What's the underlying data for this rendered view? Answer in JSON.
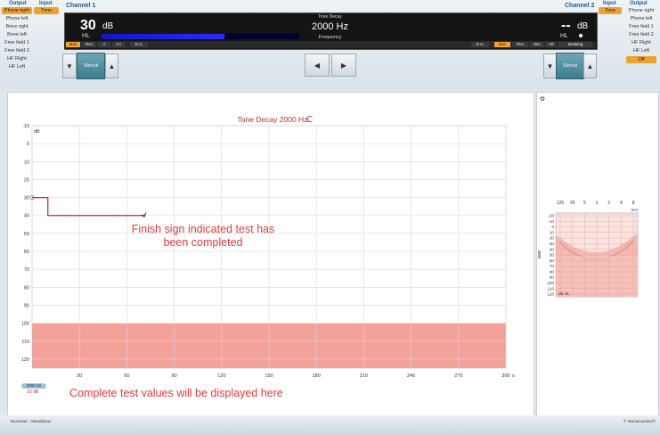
{
  "left_panel": {
    "output_header": "Output",
    "input_header": "Input",
    "outputs": [
      "Phone right",
      "Phone left",
      "Bone right",
      "Bone left",
      "Free field 1",
      "Free field 2",
      "HF Right",
      "HF Left"
    ],
    "input_value": "Tone"
  },
  "right_panel": {
    "input_header": "Input",
    "output_header": "Output",
    "input_value": "Tone",
    "outputs": [
      "Phone right",
      "Phone left",
      "Free field 1",
      "Free field 2",
      "HF Right",
      "HF Left"
    ],
    "off_label": "Off"
  },
  "channel1_label": "Channel 1",
  "channel2_label": "Channel 2",
  "display": {
    "title": "Tone Decay",
    "ch1_level": "30",
    "ch1_unit": "dB",
    "ch1_hl": "HL",
    "frequency": "2000 Hz",
    "frequency_label": "Frequency",
    "ch2_level": "--",
    "ch2_unit": "dB",
    "ch2_hl": "HL",
    "level_bar_fill": 0.62,
    "left_tabs": [
      "Man",
      "Rev",
      "⎍",
      "⎍⎍",
      "E+L"
    ],
    "right_tabs": [
      "E+L",
      "Man",
      "Rev",
      "Sim",
      "Alt",
      "Masking"
    ],
    "left_tab_active": 0,
    "right_tab_active": 1
  },
  "buttons": {
    "stimuli_left": "Stimuli",
    "stimuli_right": "Stimuli"
  },
  "chart_data": {
    "type": "line",
    "title": "Tone Decay 2000 Hz",
    "ylabel": "dB",
    "xlabel": "s",
    "x_ticks": [
      "30",
      "60",
      "90",
      "120",
      "150",
      "180",
      "210",
      "240",
      "270",
      "300"
    ],
    "y_ticks": [
      "-10",
      "0",
      "10",
      "20",
      "30",
      "40",
      "50",
      "60",
      "70",
      "80",
      "90",
      "100",
      "110",
      "120"
    ],
    "xlim": [
      0,
      300
    ],
    "ylim": [
      -10,
      125
    ],
    "shaded_region": [
      100,
      125
    ],
    "grid": true,
    "series": [
      {
        "x": [
          0,
          10,
          10,
          71
        ],
        "y": [
          30,
          30,
          40,
          40
        ]
      }
    ],
    "end_marker_x": 71,
    "end_marker_y": 40
  },
  "mini_audiogram": {
    "top_labels": [
      "125",
      "25",
      "5",
      "1",
      "2",
      "4",
      "8"
    ],
    "unit_top": "kHz",
    "y_labels": [
      "-20",
      "-10",
      "0",
      "10",
      "20",
      "30",
      "40",
      "50",
      "60",
      "70",
      "80",
      "90",
      "100",
      "110",
      "120"
    ],
    "unit_bottom": "dB HL"
  },
  "annotations": {
    "finish_note_line1": "Finish sign indicated test has",
    "finish_note_line2": "been completed",
    "complete_note": "Complete test values will be displayed here"
  },
  "legend": {
    "freq_badge": "2000 Hz",
    "value": "10 dB"
  },
  "footer": {
    "examiner": "Examiner : Standalone",
    "copyright": "© Interacoustics®"
  },
  "colors": {
    "chart_line": "#d92020",
    "shaded": "#f4a19a",
    "accent": "#f0a030",
    "level_bar": "#1a1aff"
  }
}
